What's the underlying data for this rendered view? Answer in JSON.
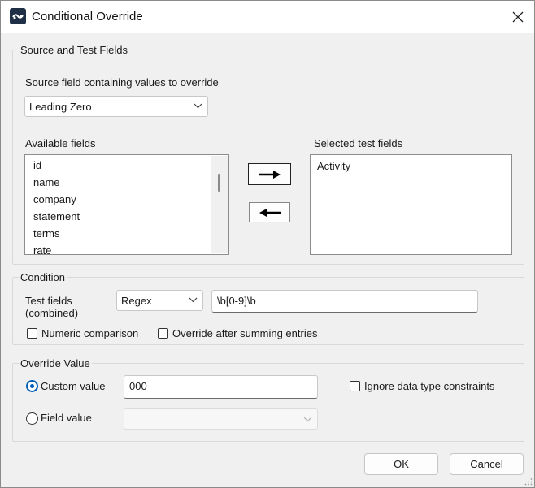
{
  "window": {
    "title": "Conditional Override",
    "icon": "app-logo-icon"
  },
  "source_group": {
    "title": "Source and Test Fields",
    "source_label": "Source field containing values to override",
    "source_value": "Leading Zero",
    "available_label": "Available fields",
    "available_fields": [
      "id",
      "name",
      "company",
      "statement",
      "terms",
      "rate"
    ],
    "selected_label": "Selected test fields",
    "selected_fields": [
      "Activity"
    ],
    "add_icon": "arrow-right-icon",
    "remove_icon": "arrow-left-icon"
  },
  "condition_group": {
    "title": "Condition",
    "test_fields_label_line1": "Test fields",
    "test_fields_label_line2": "(combined)",
    "operator_value": "Regex",
    "expression_value": "\\b[0-9]\\b",
    "numeric_label": "Numeric comparison",
    "numeric_checked": false,
    "summing_label": "Override after summing entries",
    "summing_checked": false
  },
  "override_group": {
    "title": "Override Value",
    "custom_label": "Custom value",
    "custom_selected": true,
    "custom_value": "000",
    "ignore_label": "Ignore data type constraints",
    "ignore_checked": false,
    "field_label": "Field value",
    "field_selected": false,
    "field_value": ""
  },
  "buttons": {
    "ok": "OK",
    "cancel": "Cancel"
  },
  "colors": {
    "accent": "#005fb8",
    "dialog_bg": "#f0f0f0"
  }
}
